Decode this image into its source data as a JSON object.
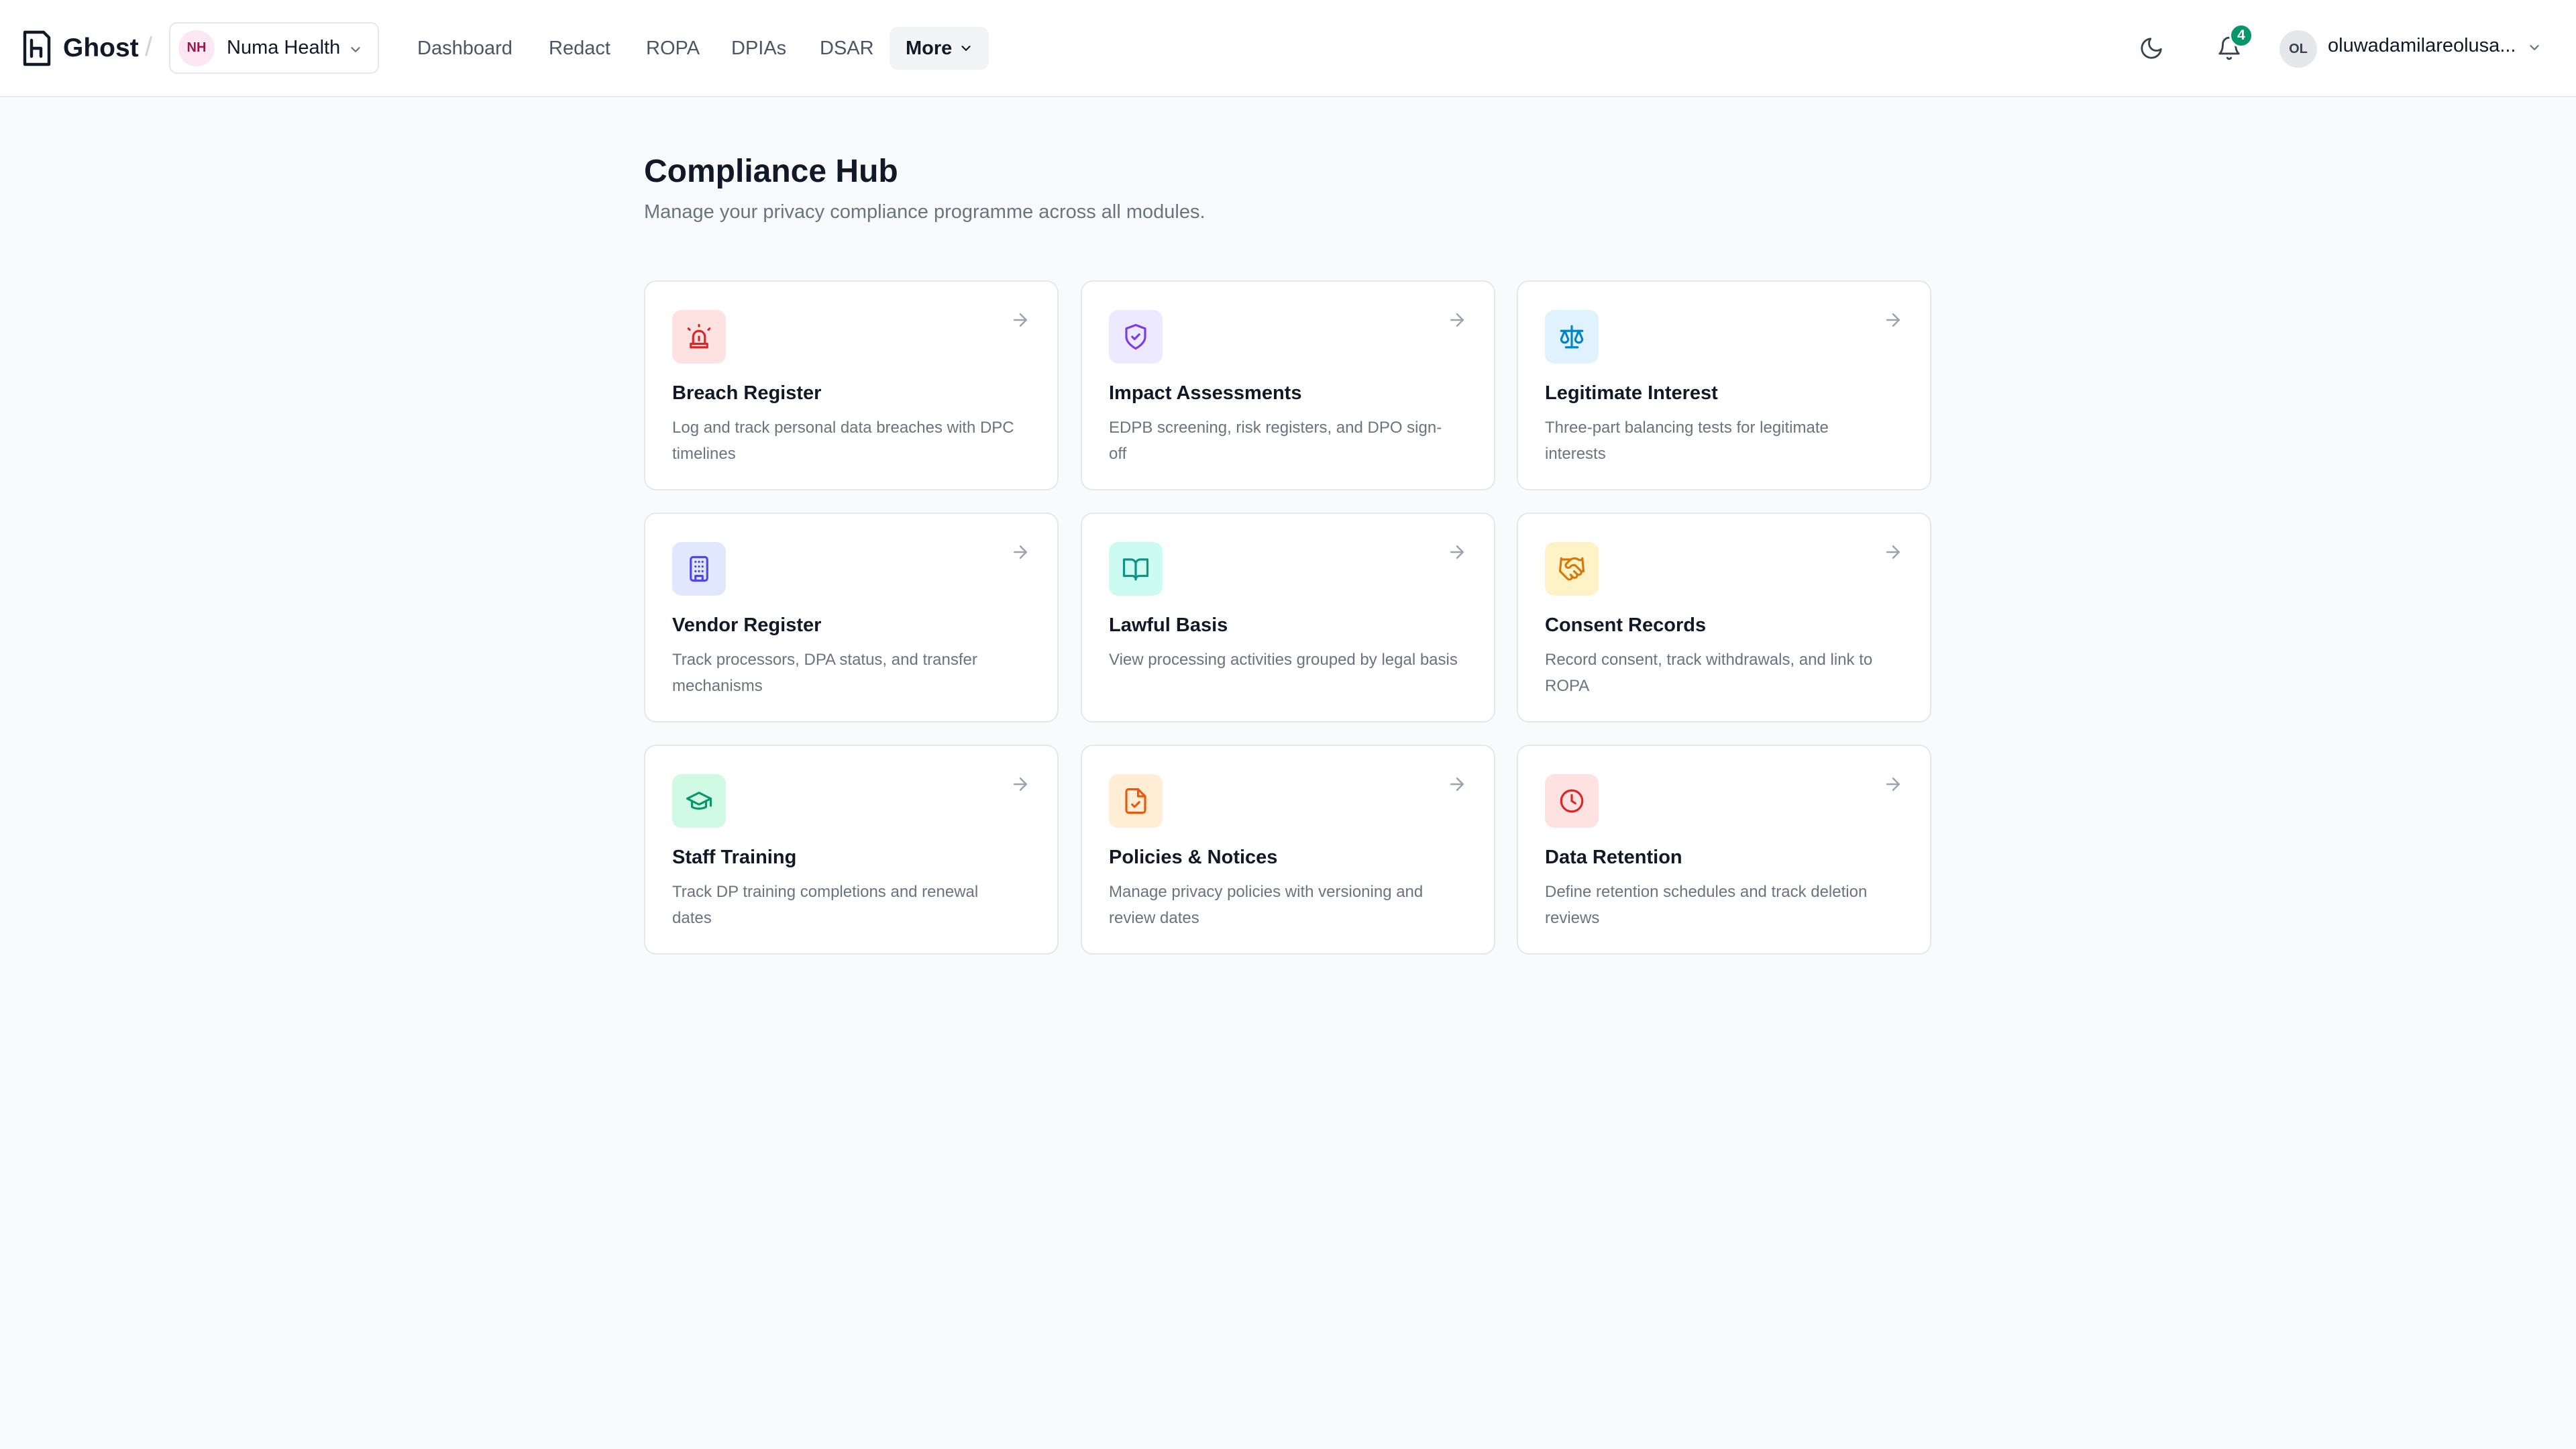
{
  "app": {
    "name": "Ghost"
  },
  "org": {
    "initials": "NH",
    "name": "Numa Health"
  },
  "nav": {
    "items": [
      "Dashboard",
      "Redact",
      "ROPA",
      "DPIAs",
      "DSAR"
    ],
    "more_label": "More"
  },
  "header": {
    "notification_count": "4",
    "user_initials": "OL",
    "user_name": "oluwadamilareolusa..."
  },
  "page": {
    "title": "Compliance Hub",
    "subtitle": "Manage your privacy compliance programme across all modules."
  },
  "modules": [
    {
      "title": "Breach Register",
      "description": "Log and track personal data breaches with DPC timelines",
      "icon": "siren-icon",
      "icon_color": "#dc2626",
      "icon_bg": "#fee2e2"
    },
    {
      "title": "Impact Assessments",
      "description": "EDPB screening, risk registers, and DPO sign-off",
      "icon": "shield-check-icon",
      "icon_color": "#7c3aed",
      "icon_bg": "#ede9fe"
    },
    {
      "title": "Legitimate Interest",
      "description": "Three-part balancing tests for legitimate interests",
      "icon": "scale-icon",
      "icon_color": "#0284c7",
      "icon_bg": "#e0f2fe"
    },
    {
      "title": "Vendor Register",
      "description": "Track processors, DPA status, and transfer mechanisms",
      "icon": "building-icon",
      "icon_color": "#4f46e5",
      "icon_bg": "#e0e7ff"
    },
    {
      "title": "Lawful Basis",
      "description": "View processing activities grouped by legal basis",
      "icon": "book-open-icon",
      "icon_color": "#0d9488",
      "icon_bg": "#ccfbf1"
    },
    {
      "title": "Consent Records",
      "description": "Record consent, track withdrawals, and link to ROPA",
      "icon": "handshake-icon",
      "icon_color": "#d97706",
      "icon_bg": "#fef3c7"
    },
    {
      "title": "Staff Training",
      "description": "Track DP training completions and renewal dates",
      "icon": "graduation-cap-icon",
      "icon_color": "#059669",
      "icon_bg": "#d1fae5"
    },
    {
      "title": "Policies & Notices",
      "description": "Manage privacy policies with versioning and review dates",
      "icon": "file-check-icon",
      "icon_color": "#ea580c",
      "icon_bg": "#ffedd5"
    },
    {
      "title": "Data Retention",
      "description": "Define retention schedules and track deletion reviews",
      "icon": "clock-icon",
      "icon_color": "#dc2626",
      "icon_bg": "#fee2e2"
    }
  ]
}
